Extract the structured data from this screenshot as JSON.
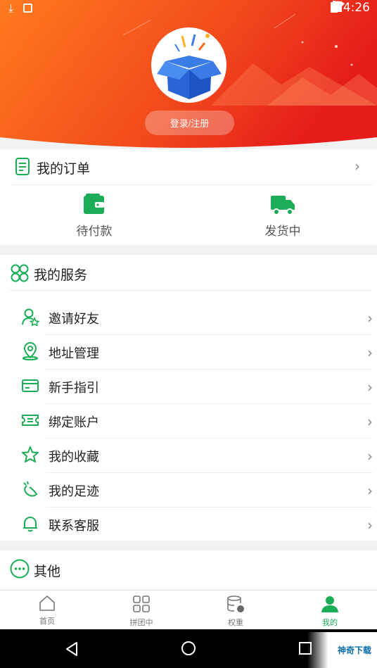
{
  "status_bar": {
    "time": "4:26"
  },
  "header": {
    "login_label": "登录/注册"
  },
  "orders": {
    "title": "我的订单",
    "items": [
      {
        "label": "待付款",
        "icon": "wallet-icon"
      },
      {
        "label": "发货中",
        "icon": "truck-icon"
      }
    ]
  },
  "services": {
    "title": "我的服务",
    "items": [
      {
        "label": "邀请好友",
        "icon": "invite-friend-icon"
      },
      {
        "label": "地址管理",
        "icon": "location-pin-icon"
      },
      {
        "label": "新手指引",
        "icon": "card-icon"
      },
      {
        "label": "绑定账户",
        "icon": "ticket-icon"
      },
      {
        "label": "我的收藏",
        "icon": "star-icon"
      },
      {
        "label": "我的足迹",
        "icon": "footprint-icon"
      },
      {
        "label": "联系客服",
        "icon": "bell-icon"
      }
    ]
  },
  "other": {
    "title": "其他"
  },
  "tabbar": {
    "tabs": [
      {
        "label": "首页",
        "icon": "home-icon"
      },
      {
        "label": "拼团中",
        "icon": "grid-icon"
      },
      {
        "label": "权重",
        "icon": "database-icon"
      },
      {
        "label": "我的",
        "icon": "user-icon"
      }
    ],
    "active_index": 3
  },
  "watermark": {
    "text": "神奇下载"
  },
  "colors": {
    "accent_green": "#1aad55",
    "header_orange": "#ff6a1a",
    "header_red": "#e8201c"
  }
}
